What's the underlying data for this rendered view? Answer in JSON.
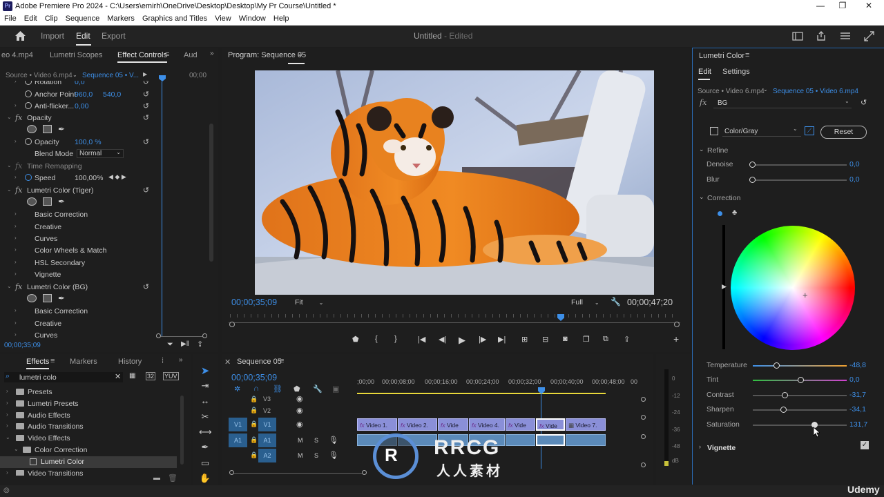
{
  "window": {
    "app_logo": "Pr",
    "title": "Adobe Premiere Pro 2024 - C:\\Users\\emirh\\OneDrive\\Desktop\\Desktop\\My Pr Course\\Untitled *",
    "controls": [
      "—",
      "❐",
      "✕"
    ]
  },
  "menu": [
    "File",
    "Edit",
    "Clip",
    "Sequence",
    "Markers",
    "Graphics and Titles",
    "View",
    "Window",
    "Help"
  ],
  "header": {
    "import": "Import",
    "edit": "Edit",
    "export": "Export",
    "doc_title": "Untitled",
    "doc_status": "- Edited"
  },
  "effect_controls": {
    "tabs": [
      "eo 4.mp4",
      "Lumetri Scopes",
      "Effect Controls",
      "Aud"
    ],
    "source": "Source • Video 6.mp4",
    "sequence": "Sequence 05 • V...",
    "ruler_time": "00;00",
    "rows": {
      "rotation": "Rotation",
      "rotation_val": "0,0",
      "anchor": "Anchor Point",
      "anchor_x": "960,0",
      "anchor_y": "540,0",
      "antiflicker": "Anti-flicker...",
      "antiflicker_val": "0,00",
      "opacity_fx": "Opacity",
      "opacity": "Opacity",
      "opacity_val": "100,0 %",
      "blend": "Blend Mode",
      "blend_val": "Normal",
      "time_remap": "Time Remapping",
      "speed": "Speed",
      "speed_val": "100,00%",
      "lumetri_tiger": "Lumetri Color (Tiger)",
      "basic1": "Basic Correction",
      "creative1": "Creative",
      "curves1": "Curves",
      "wheels": "Color Wheels & Match",
      "hsl": "HSL Secondary",
      "vignette": "Vignette",
      "lumetri_bg": "Lumetri Color (BG)",
      "basic2": "Basic Correction",
      "creative2": "Creative",
      "curves2": "Curves"
    },
    "timecode": "00;00;35;09"
  },
  "program": {
    "title": "Program: Sequence 05",
    "timecode": "00;00;35;09",
    "fit": "Fit",
    "quality": "Full",
    "duration": "00;00;47;20"
  },
  "lumetri": {
    "title": "Lumetri Color",
    "tab_edit": "Edit",
    "tab_settings": "Settings",
    "source": "Source • Video 6.mp4",
    "sequence": "Sequence 05 • Video 6.mp4",
    "fx": "fx",
    "effect_name": "BG",
    "mode": "Color/Gray",
    "reset": "Reset",
    "refine": "Refine",
    "denoise": "Denoise",
    "denoise_val": "0,0",
    "blur": "Blur",
    "blur_val": "0,0",
    "correction": "Correction",
    "temperature": "Temperature",
    "temperature_val": "-48,8",
    "tint": "Tint",
    "tint_val": "0,0",
    "contrast": "Contrast",
    "contrast_val": "-31,7",
    "sharpen": "Sharpen",
    "sharpen_val": "-34,1",
    "saturation": "Saturation",
    "saturation_val": "131,7",
    "vignette": "Vignette"
  },
  "effects_panel": {
    "tabs": [
      "Effects",
      "Markers",
      "History"
    ],
    "search_value": "lumetri colo",
    "tree": [
      "Presets",
      "Lumetri Presets",
      "Audio Effects",
      "Audio Transitions",
      "Video Effects",
      "Color Correction",
      "Lumetri Color",
      "Video Transitions"
    ]
  },
  "timeline": {
    "title": "Sequence 05",
    "timecode": "00;00;35;09",
    "ruler": [
      ";00;00",
      "00;00;08;00",
      "00;00;16;00",
      "00;00;24;00",
      "00;00;32;00",
      "00;00;40;00",
      "00;00;48;00",
      "00"
    ],
    "tracks": [
      "V3",
      "V2",
      "V1",
      "A1",
      "A2"
    ],
    "patch_v1": "V1",
    "patch_a1": "A1",
    "clips": [
      "Video 1.",
      "Video 2.",
      "Vide",
      "Video 4.",
      "Vide",
      "Vide",
      "Video 7."
    ],
    "mute": "M",
    "solo": "S"
  },
  "meters": {
    "scale": [
      "0",
      "-12",
      "-24",
      "-36",
      "-48",
      "dB"
    ]
  },
  "overlay": {
    "watermark": "RRCG",
    "watermark_sub": "人人素材",
    "brand": "Udemy"
  }
}
